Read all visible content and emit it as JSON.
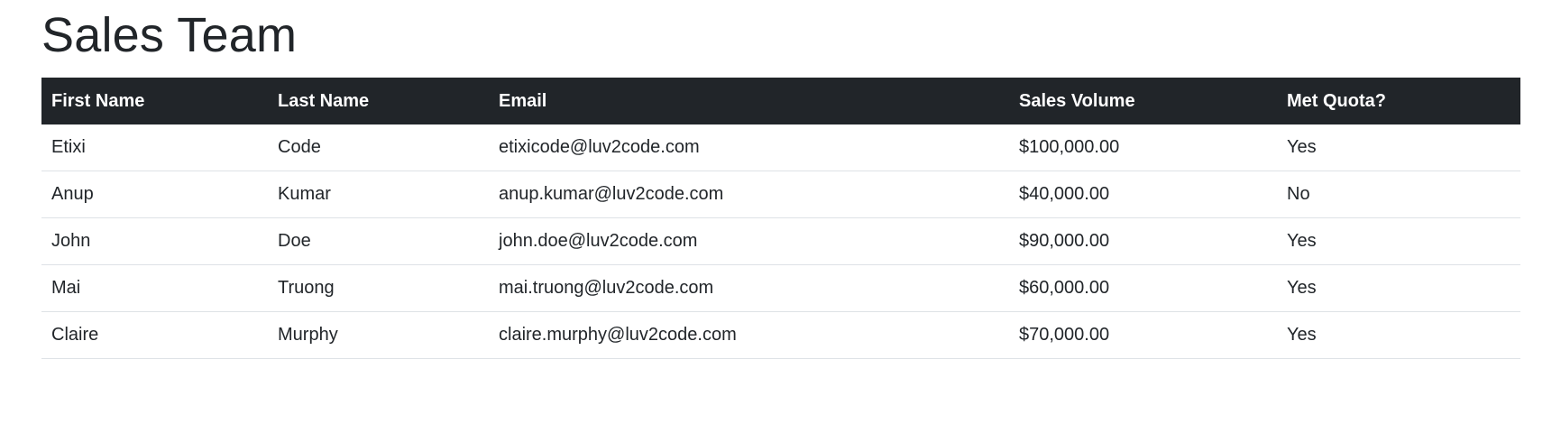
{
  "page": {
    "title": "Sales Team"
  },
  "table": {
    "headers": {
      "first_name": "First Name",
      "last_name": "Last Name",
      "email": "Email",
      "sales_volume": "Sales Volume",
      "met_quota": "Met Quota?"
    },
    "rows": [
      {
        "first_name": "Etixi",
        "last_name": "Code",
        "email": "etixicode@luv2code.com",
        "sales_volume": "$100,000.00",
        "met_quota": "Yes"
      },
      {
        "first_name": "Anup",
        "last_name": "Kumar",
        "email": "anup.kumar@luv2code.com",
        "sales_volume": "$40,000.00",
        "met_quota": "No"
      },
      {
        "first_name": "John",
        "last_name": "Doe",
        "email": "john.doe@luv2code.com",
        "sales_volume": "$90,000.00",
        "met_quota": "Yes"
      },
      {
        "first_name": "Mai",
        "last_name": "Truong",
        "email": "mai.truong@luv2code.com",
        "sales_volume": "$60,000.00",
        "met_quota": "Yes"
      },
      {
        "first_name": "Claire",
        "last_name": "Murphy",
        "email": "claire.murphy@luv2code.com",
        "sales_volume": "$70,000.00",
        "met_quota": "Yes"
      }
    ]
  },
  "colors": {
    "header_bg": "#212529",
    "header_text": "#ffffff",
    "body_text": "#212529",
    "row_border": "#dee2e6"
  }
}
